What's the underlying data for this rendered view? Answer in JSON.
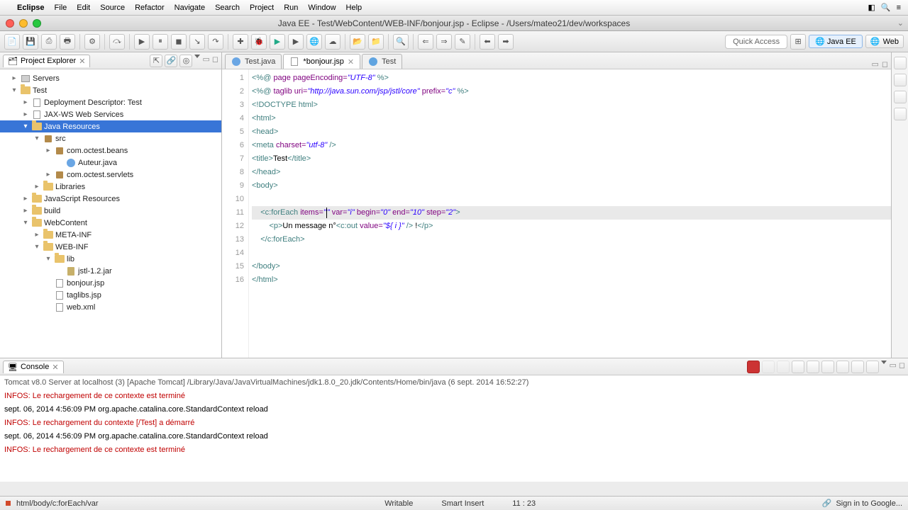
{
  "menubar": {
    "app": "Eclipse",
    "items": [
      "File",
      "Edit",
      "Source",
      "Refactor",
      "Navigate",
      "Search",
      "Project",
      "Run",
      "Window",
      "Help"
    ]
  },
  "window": {
    "title": "Java EE - Test/WebContent/WEB-INF/bonjour.jsp - Eclipse - /Users/mateo21/dev/workspaces"
  },
  "toolbar": {
    "quick_access": "Quick Access",
    "perspective": "Java EE",
    "web": "Web"
  },
  "explorer": {
    "title": "Project Explorer",
    "nodes": [
      {
        "pad": 14,
        "tw": "▸",
        "icon": "srv",
        "label": "Servers"
      },
      {
        "pad": 14,
        "tw": "▾",
        "icon": "folder",
        "label": "Test"
      },
      {
        "pad": 30,
        "tw": "▸",
        "icon": "file",
        "label": "Deployment Descriptor: Test"
      },
      {
        "pad": 30,
        "tw": "▸",
        "icon": "file",
        "label": "JAX-WS Web Services"
      },
      {
        "pad": 30,
        "tw": "▾",
        "icon": "folder",
        "label": "Java Resources",
        "sel": true
      },
      {
        "pad": 46,
        "tw": "▾",
        "icon": "pkg",
        "label": "src"
      },
      {
        "pad": 62,
        "tw": "▸",
        "icon": "pkg",
        "label": "com.octest.beans"
      },
      {
        "pad": 78,
        "tw": "",
        "icon": "java",
        "label": "Auteur.java"
      },
      {
        "pad": 62,
        "tw": "▸",
        "icon": "pkg",
        "label": "com.octest.servlets"
      },
      {
        "pad": 46,
        "tw": "▸",
        "icon": "folder",
        "label": "Libraries"
      },
      {
        "pad": 30,
        "tw": "▸",
        "icon": "folder",
        "label": "JavaScript Resources"
      },
      {
        "pad": 30,
        "tw": "▸",
        "icon": "folder",
        "label": "build"
      },
      {
        "pad": 30,
        "tw": "▾",
        "icon": "folder",
        "label": "WebContent"
      },
      {
        "pad": 46,
        "tw": "▸",
        "icon": "folder",
        "label": "META-INF"
      },
      {
        "pad": 46,
        "tw": "▾",
        "icon": "folder",
        "label": "WEB-INF"
      },
      {
        "pad": 62,
        "tw": "▾",
        "icon": "folder",
        "label": "lib"
      },
      {
        "pad": 78,
        "tw": "",
        "icon": "jar",
        "label": "jstl-1.2.jar"
      },
      {
        "pad": 62,
        "tw": "",
        "icon": "file",
        "label": "bonjour.jsp"
      },
      {
        "pad": 62,
        "tw": "",
        "icon": "file",
        "label": "taglibs.jsp"
      },
      {
        "pad": 62,
        "tw": "",
        "icon": "file",
        "label": "web.xml"
      }
    ]
  },
  "editor": {
    "tabs": [
      {
        "label": "Test.java",
        "active": false,
        "dirty": false,
        "icon": "java"
      },
      {
        "label": "*bonjour.jsp",
        "active": true,
        "dirty": true,
        "icon": "file"
      },
      {
        "label": "Test",
        "active": false,
        "dirty": false,
        "icon": "globe"
      }
    ],
    "highlight_line": 11,
    "lines": [
      {
        "n": 1,
        "seg": [
          [
            "t-dir",
            "<%@"
          ],
          [
            "t-txt",
            " "
          ],
          [
            "t-attr",
            "page pageEncoding="
          ],
          [
            "t-str",
            "\"UTF-8\""
          ],
          [
            "t-txt",
            " "
          ],
          [
            "t-dir",
            "%>"
          ]
        ]
      },
      {
        "n": 2,
        "seg": [
          [
            "t-dir",
            "<%@"
          ],
          [
            "t-txt",
            " "
          ],
          [
            "t-attr",
            "taglib uri="
          ],
          [
            "t-str",
            "\"http://java.sun.com/jsp/jstl/core\""
          ],
          [
            "t-txt",
            " "
          ],
          [
            "t-attr",
            "prefix="
          ],
          [
            "t-str",
            "\"c\""
          ],
          [
            "t-txt",
            " "
          ],
          [
            "t-dir",
            "%>"
          ]
        ]
      },
      {
        "n": 3,
        "seg": [
          [
            "t-dir",
            "<!DOCTYPE html>"
          ]
        ]
      },
      {
        "n": 4,
        "seg": [
          [
            "t-dir",
            "<html>"
          ]
        ]
      },
      {
        "n": 5,
        "seg": [
          [
            "t-dir",
            "<head>"
          ]
        ]
      },
      {
        "n": 6,
        "seg": [
          [
            "t-dir",
            "<meta"
          ],
          [
            "t-txt",
            " "
          ],
          [
            "t-attr",
            "charset="
          ],
          [
            "t-str",
            "\"utf-8\""
          ],
          [
            "t-txt",
            " "
          ],
          [
            "t-dir",
            "/>"
          ]
        ]
      },
      {
        "n": 7,
        "seg": [
          [
            "t-dir",
            "<title>"
          ],
          [
            "t-txt",
            "Test"
          ],
          [
            "t-dir",
            "</title>"
          ]
        ]
      },
      {
        "n": 8,
        "seg": [
          [
            "t-dir",
            "</head>"
          ]
        ]
      },
      {
        "n": 9,
        "seg": [
          [
            "t-dir",
            "<body>"
          ]
        ]
      },
      {
        "n": 10,
        "seg": []
      },
      {
        "n": 11,
        "seg": [
          [
            "t-txt",
            "    "
          ],
          [
            "t-dir",
            "<c:forEach"
          ],
          [
            "t-txt",
            " "
          ],
          [
            "t-attr",
            "items="
          ],
          [
            "t-str",
            "\""
          ],
          [
            "caret",
            ""
          ],
          [
            "t-str",
            "\""
          ],
          [
            "t-txt",
            " "
          ],
          [
            "t-attr",
            "var="
          ],
          [
            "t-str",
            "\"i\""
          ],
          [
            "t-txt",
            " "
          ],
          [
            "t-attr",
            "begin="
          ],
          [
            "t-str",
            "\"0\""
          ],
          [
            "t-txt",
            " "
          ],
          [
            "t-attr",
            "end="
          ],
          [
            "t-str",
            "\"10\""
          ],
          [
            "t-txt",
            " "
          ],
          [
            "t-attr",
            "step="
          ],
          [
            "t-str",
            "\"2\""
          ],
          [
            "t-dir",
            ">"
          ]
        ]
      },
      {
        "n": 12,
        "seg": [
          [
            "t-txt",
            "        "
          ],
          [
            "t-dir",
            "<p>"
          ],
          [
            "t-txt",
            "Un message n°"
          ],
          [
            "t-dir",
            "<c:out"
          ],
          [
            "t-txt",
            " "
          ],
          [
            "t-attr",
            "value="
          ],
          [
            "t-str",
            "\"${ i }\""
          ],
          [
            "t-txt",
            " "
          ],
          [
            "t-dir",
            "/>"
          ],
          [
            "t-txt",
            " !"
          ],
          [
            "t-dir",
            "</p>"
          ]
        ]
      },
      {
        "n": 13,
        "seg": [
          [
            "t-txt",
            "    "
          ],
          [
            "t-dir",
            "</c:forEach>"
          ]
        ]
      },
      {
        "n": 14,
        "seg": []
      },
      {
        "n": 15,
        "seg": [
          [
            "t-dir",
            "</body>"
          ]
        ]
      },
      {
        "n": 16,
        "seg": [
          [
            "t-dir",
            "</html>"
          ]
        ]
      }
    ]
  },
  "console": {
    "title": "Console",
    "subtitle": "Tomcat v8.0 Server at localhost (3) [Apache Tomcat] /Library/Java/JavaVirtualMachines/jdk1.8.0_20.jdk/Contents/Home/bin/java (6 sept. 2014 16:52:27)",
    "lines": [
      {
        "cls": "info",
        "text": "INFOS: Le rechargement de ce contexte est terminé"
      },
      {
        "cls": "plain",
        "text": "sept. 06, 2014 4:56:09 PM org.apache.catalina.core.StandardContext reload"
      },
      {
        "cls": "info",
        "text": "INFOS: Le rechargement du contexte [/Test] a démarré"
      },
      {
        "cls": "plain",
        "text": "sept. 06, 2014 4:56:09 PM org.apache.catalina.core.StandardContext reload"
      },
      {
        "cls": "info",
        "text": "INFOS: Le rechargement de ce contexte est terminé"
      }
    ]
  },
  "status": {
    "path": "html/body/c:forEach/var",
    "writable": "Writable",
    "insert": "Smart Insert",
    "pos": "11 : 23",
    "signin": "Sign in to Google..."
  }
}
